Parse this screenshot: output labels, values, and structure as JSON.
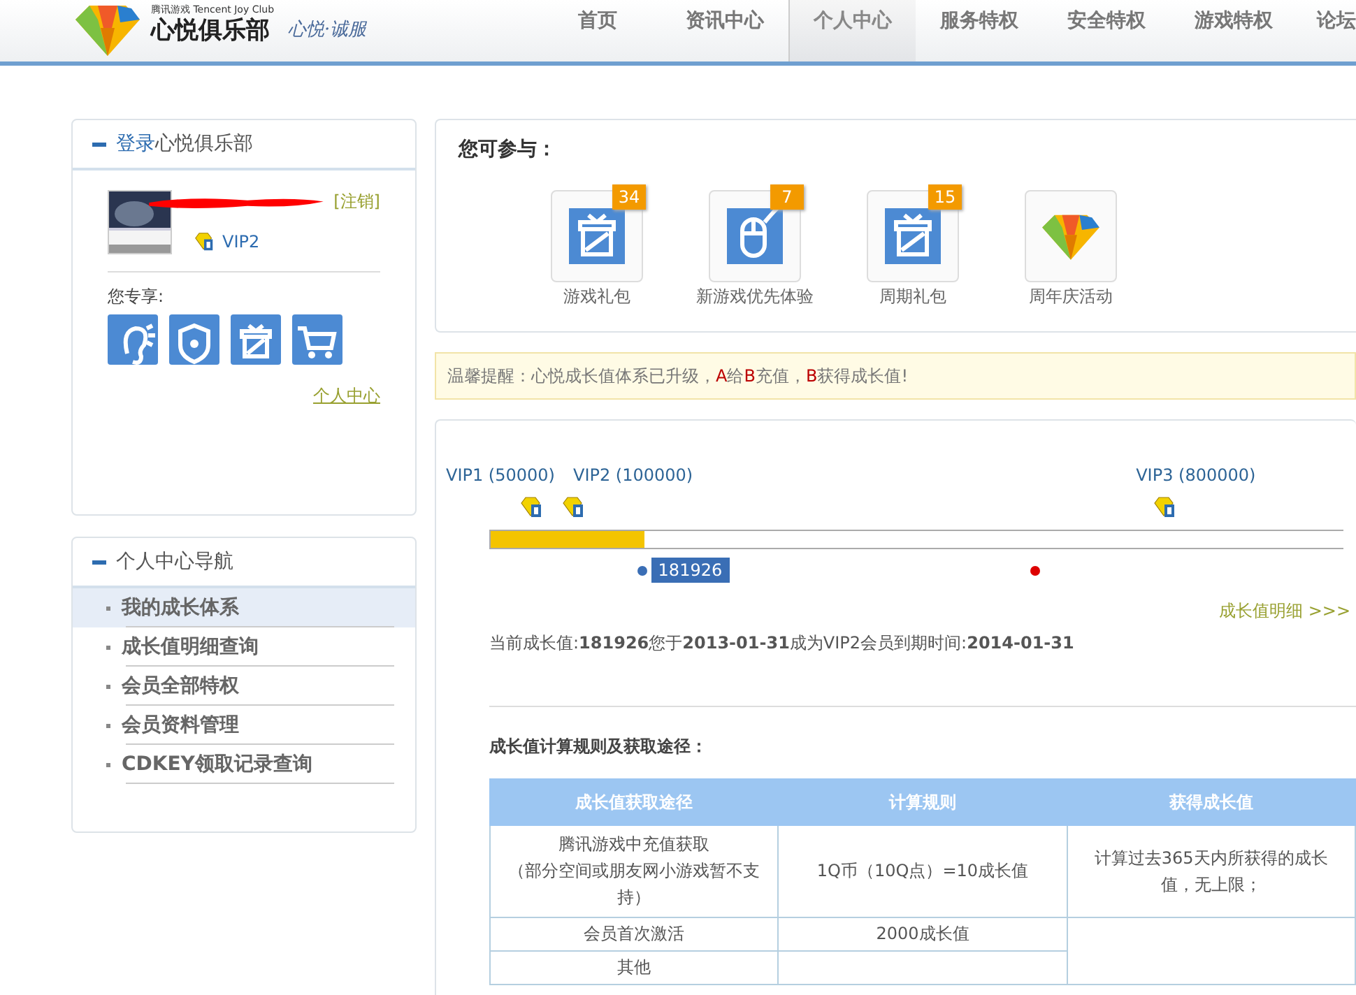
{
  "header": {
    "brand_small": "腾讯游戏 Tencent Joy Club",
    "brand": "心悦俱乐部",
    "slogan": "心悦·诚服",
    "nav": [
      {
        "label": "首页",
        "selected": false
      },
      {
        "label": "资讯中心",
        "selected": false
      },
      {
        "label": "个人中心",
        "selected": true
      },
      {
        "label": "服务特权",
        "selected": false
      },
      {
        "label": "安全特权",
        "selected": false
      },
      {
        "label": "游戏特权",
        "selected": false
      },
      {
        "label": "论坛",
        "selected": false
      }
    ]
  },
  "login_panel": {
    "title_link": "登录",
    "title": "心悦俱乐部",
    "logout": "[注销]",
    "vip": "VIP2",
    "exclusive_label": "您专享:",
    "perks": [
      {
        "kind": "ear"
      },
      {
        "kind": "shield"
      },
      {
        "kind": "gift"
      },
      {
        "kind": "cart"
      }
    ],
    "link": "个人中心"
  },
  "nav_panel": {
    "title": "个人中心导航",
    "items": [
      {
        "label": "我的成长体系",
        "selected": true
      },
      {
        "label": "成长值明细查询",
        "selected": false
      },
      {
        "label": "会员全部特权",
        "selected": false
      },
      {
        "label": "会员资料管理",
        "selected": false
      },
      {
        "label": "CDKEY领取记录查询",
        "selected": false
      }
    ]
  },
  "participate": {
    "title": "您可参与：",
    "items": [
      {
        "kind": "gift",
        "label": "游戏礼包",
        "badge": "34"
      },
      {
        "kind": "mouse",
        "label": "新游戏优先体验",
        "badge": "7"
      },
      {
        "kind": "gift",
        "label": "周期礼包",
        "badge": "15"
      },
      {
        "kind": "logo",
        "label": "周年庆活动"
      }
    ]
  },
  "notice": [
    {
      "kind": "plain",
      "text": "温馨提醒：心悦成长值体系已升级，"
    },
    {
      "kind": "accent",
      "text": "A"
    },
    {
      "kind": "plain",
      "text": "给"
    },
    {
      "kind": "accent",
      "text": "B"
    },
    {
      "kind": "plain",
      "text": "充值，"
    },
    {
      "kind": "accent",
      "text": "B"
    },
    {
      "kind": "plain",
      "text": "获得成长值!"
    }
  ],
  "growth": {
    "milestones": [
      {
        "label": "VIP1 (50000)"
      },
      {
        "label": "VIP2 (100000)"
      },
      {
        "label": "VIP3 (800000)"
      }
    ],
    "level": 0.18,
    "current": "181926",
    "detail_link": "成长值明细 >>>",
    "status": "当前成长值:**181926**您于**2013-01-31**成为VIP2会员到期时间:**2014-01-31**"
  },
  "rules": {
    "title": "成长值计算规则及获取途径：",
    "columns": [
      "成长值获取途径",
      "计算规则",
      "获得成长值"
    ],
    "rows": [
      [
        [
          "腾讯游戏中充值获取",
          "（部分空间或朋友网小游戏暂不支持）"
        ],
        "1Q币（10Q点）=10成长值",
        "计算过去365天内所获得的成长值，无上限；"
      ],
      [
        "会员首次激活",
        "2000成长值"
      ],
      [
        "其他"
      ]
    ]
  }
}
